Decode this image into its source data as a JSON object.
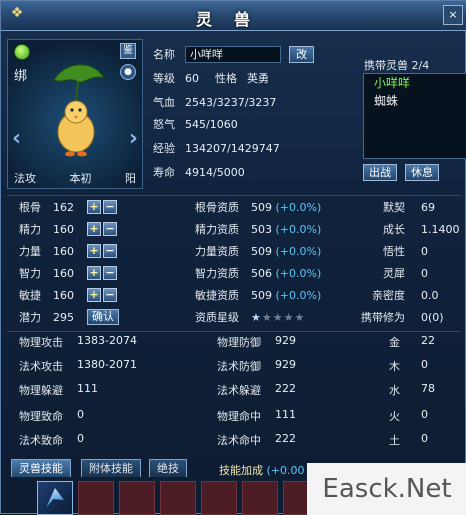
{
  "window": {
    "title": "灵兽",
    "close": "×"
  },
  "portrait": {
    "bind_label": "绑",
    "key_button": "鉴",
    "lock_button": "●",
    "left_arrow": "‹",
    "right_arrow": "›",
    "labels": [
      "法攻",
      "本初",
      "阳"
    ]
  },
  "info": {
    "name_label": "名称",
    "name_value": "小咩咩",
    "rename_button": "改",
    "level_label": "等级",
    "level_value": "60",
    "personality_label": "性格",
    "personality_value": "英勇",
    "hp_label": "气血",
    "hp_value": "2543/3237/3237",
    "rage_label": "怒气",
    "rage_value": "545/1060",
    "exp_label": "经验",
    "exp_value": "134207/1429747",
    "life_label": "寿命",
    "life_value": "4914/5000"
  },
  "carry": {
    "title": "携带灵兽",
    "count": "2/4",
    "items": [
      "小咩咩",
      "蜘蛛"
    ],
    "battle_button": "出战",
    "rest_button": "休息"
  },
  "stats": {
    "rows": [
      {
        "label": "根骨",
        "value": "162",
        "apt_label": "根骨资质",
        "apt_value": "509",
        "apt_bonus": "(+0.0%)",
        "r_label": "默契",
        "r_value": "69"
      },
      {
        "label": "精力",
        "value": "160",
        "apt_label": "精力资质",
        "apt_value": "503",
        "apt_bonus": "(+0.0%)",
        "r_label": "成长",
        "r_value": "1.1400"
      },
      {
        "label": "力量",
        "value": "160",
        "apt_label": "力量资质",
        "apt_value": "509",
        "apt_bonus": "(+0.0%)",
        "r_label": "悟性",
        "r_value": "0"
      },
      {
        "label": "智力",
        "value": "160",
        "apt_label": "智力资质",
        "apt_value": "506",
        "apt_bonus": "(+0.0%)",
        "r_label": "灵犀",
        "r_value": "0"
      },
      {
        "label": "敏捷",
        "value": "160",
        "apt_label": "敏捷资质",
        "apt_value": "509",
        "apt_bonus": "(+0.0%)",
        "r_label": "亲密度",
        "r_value": "0.0"
      }
    ],
    "potential_label": "潜力",
    "potential_value": "295",
    "confirm_button": "确认",
    "quality_label": "资质星级",
    "quality_stars": 1,
    "quality_stars_max": 5,
    "carry_level_label": "携带修为",
    "carry_level_value": "0(0)"
  },
  "combat": {
    "rows": [
      {
        "k1": "物理攻击",
        "v1": "1383-2074",
        "k2": "物理防御",
        "v2": "929",
        "k3": "金",
        "v3": "22"
      },
      {
        "k1": "法术攻击",
        "v1": "1380-2071",
        "k2": "法术防御",
        "v2": "929",
        "k3": "木",
        "v3": "0"
      },
      {
        "k1": "物理躲避",
        "v1": "111",
        "k2": "法术躲避",
        "v2": "222",
        "k3": "水",
        "v3": "78"
      },
      {
        "k1": "物理致命",
        "v1": "0",
        "k2": "物理命中",
        "v2": "111",
        "k3": "火",
        "v3": "0"
      },
      {
        "k1": "法术致命",
        "v1": "0",
        "k2": "法术命中",
        "v2": "222",
        "k3": "土",
        "v3": "0"
      }
    ]
  },
  "tabs": {
    "items": [
      "灵兽技能",
      "附体技能",
      "绝技"
    ],
    "skill_bonus_label": "技能加成",
    "skill_bonus_value": "(+0.00"
  },
  "watermark": "Easck.Net"
}
